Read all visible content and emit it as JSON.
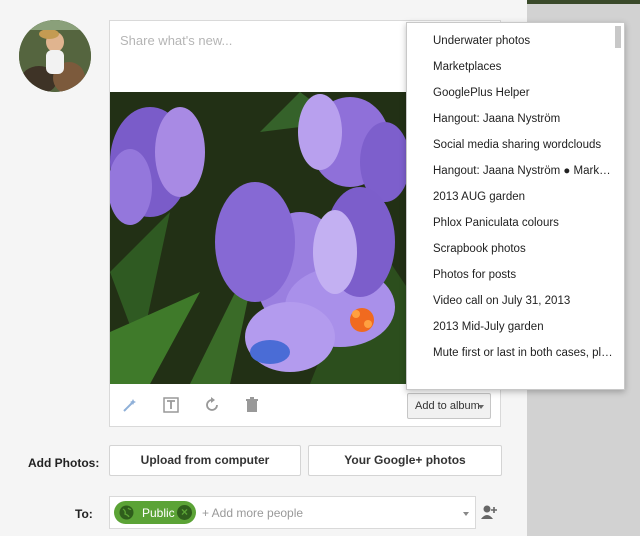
{
  "share": {
    "placeholder": "Share what's new..."
  },
  "album_button": {
    "label": "Add to album"
  },
  "album_menu": {
    "items": [
      "Underwater photos",
      "Marketplaces",
      "GooglePlus Helper",
      "Hangout: Jaana Nyström",
      "Social media sharing wordclouds",
      "Hangout: Jaana Nyström ● Mark…",
      "2013 AUG garden",
      "Phlox Paniculata colours",
      "Scrapbook photos",
      "Photos for posts",
      "Video call on July 31, 2013",
      "2013 Mid-July garden",
      "Mute first or last in both cases, pl…"
    ]
  },
  "add_photos": {
    "label": "Add Photos:",
    "upload_label": "Upload from computer",
    "google_label": "Your Google+ photos"
  },
  "to": {
    "label": "To:",
    "chip_label": "Public",
    "placeholder": "+ Add more people"
  },
  "colors": {
    "chip_green": "#5ba336",
    "flower_purple": "#8a6fd6"
  },
  "icons": [
    "auto-enhance-icon",
    "text-icon",
    "rotate-icon",
    "trash-icon",
    "globe-icon",
    "remove-icon",
    "add-person-icon"
  ]
}
